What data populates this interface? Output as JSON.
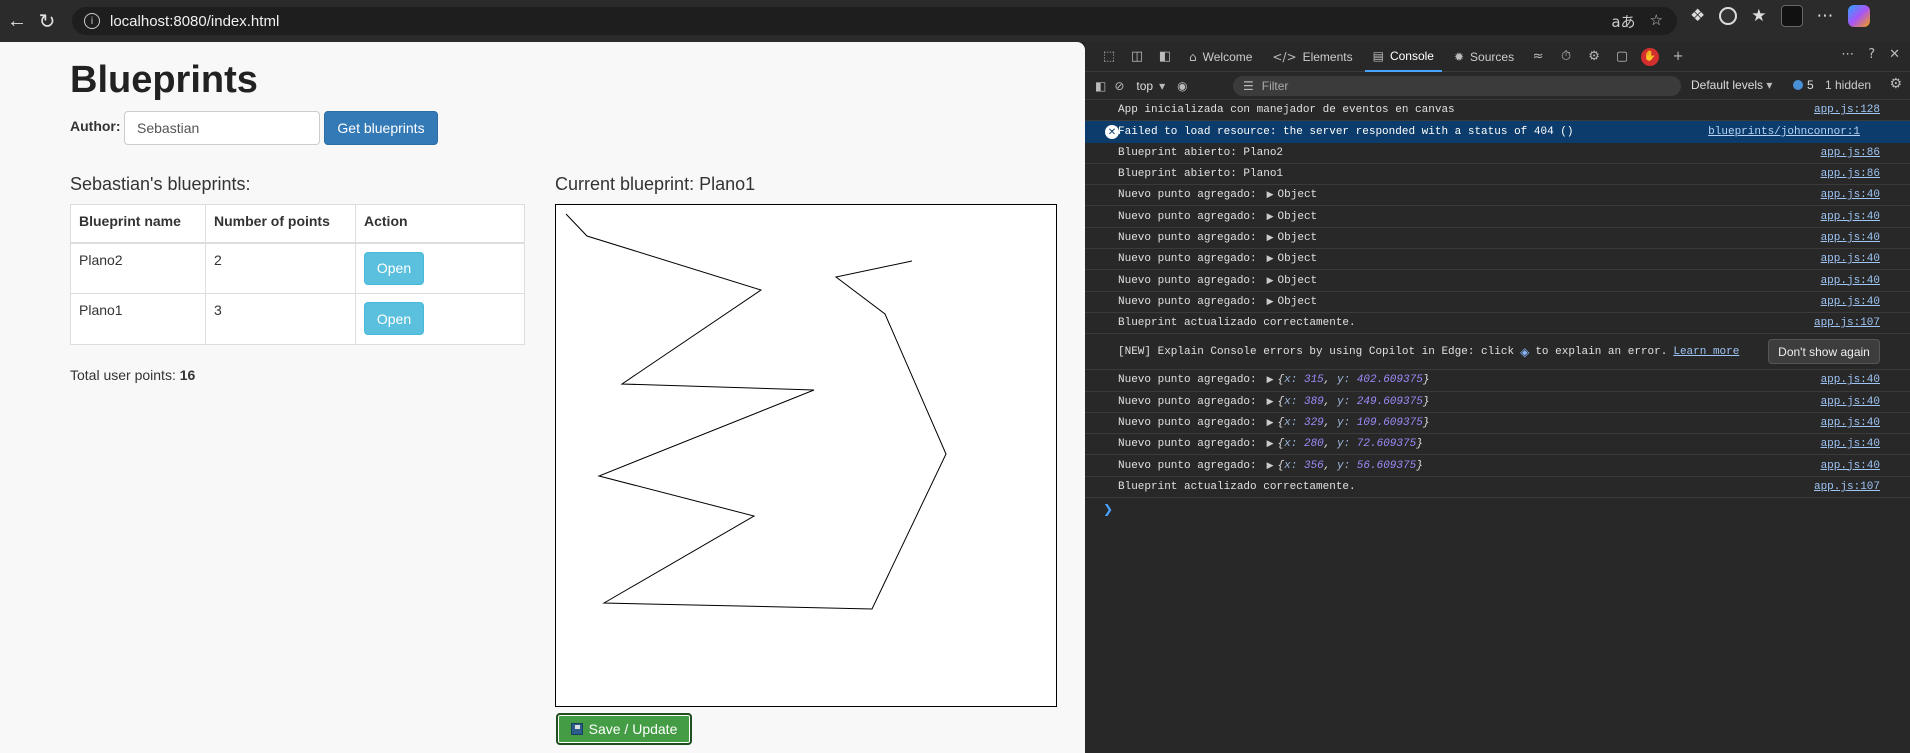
{
  "browser": {
    "url": "localhost:8080/index.html"
  },
  "app": {
    "title": "Blueprints",
    "author_label": "Author:",
    "author_value": "Sebastian",
    "get_button": "Get blueprints",
    "list_title": "Sebastian's blueprints:",
    "table": {
      "headers": [
        "Blueprint name",
        "Number of points",
        "Action"
      ],
      "rows": [
        {
          "name": "Plano2",
          "points": "2",
          "action": "Open"
        },
        {
          "name": "Plano1",
          "points": "3",
          "action": "Open"
        }
      ]
    },
    "total_label": "Total user points:",
    "total_value": "16",
    "current_title": "Current blueprint: Plano1",
    "save_button": "Save / Update"
  },
  "devtools": {
    "tabs": [
      "Welcome",
      "Elements",
      "Console",
      "Sources"
    ],
    "context": "top",
    "filter_placeholder": "Filter",
    "levels": "Default levels",
    "issues_count": "5",
    "hidden": "1 hidden",
    "logs": [
      {
        "text": "App inicializada con manejador de eventos en canvas",
        "src": "app.js:128"
      },
      {
        "text": "Failed to load resource: the server responded with a status of 404 ()",
        "src": "blueprints/johnconnor:1",
        "error": true
      },
      {
        "text": "Blueprint abierto: Plano2",
        "src": "app.js:86"
      },
      {
        "text": "Blueprint abierto: Plano1",
        "src": "app.js:86"
      },
      {
        "text": "Nuevo punto agregado:",
        "obj": "Object",
        "src": "app.js:40"
      },
      {
        "text": "Nuevo punto agregado:",
        "obj": "Object",
        "src": "app.js:40"
      },
      {
        "text": "Nuevo punto agregado:",
        "obj": "Object",
        "src": "app.js:40"
      },
      {
        "text": "Nuevo punto agregado:",
        "obj": "Object",
        "src": "app.js:40"
      },
      {
        "text": "Nuevo punto agregado:",
        "obj": "Object",
        "src": "app.js:40"
      },
      {
        "text": "Nuevo punto agregado:",
        "obj": "Object",
        "src": "app.js:40"
      },
      {
        "text": "Blueprint actualizado correctamente.",
        "src": "app.js:107"
      }
    ],
    "copilot_text_1": "[NEW] Explain Console errors by using Copilot in Edge: click",
    "copilot_text_2": "to explain an error.",
    "copilot_link": "Learn more",
    "dont_show": "Don't show again",
    "logs2": [
      {
        "text": "Nuevo punto agregado:",
        "x": "315",
        "y": "402.609375",
        "src": "app.js:40"
      },
      {
        "text": "Nuevo punto agregado:",
        "x": "389",
        "y": "249.609375",
        "src": "app.js:40"
      },
      {
        "text": "Nuevo punto agregado:",
        "x": "329",
        "y": "109.609375",
        "src": "app.js:40"
      },
      {
        "text": "Nuevo punto agregado:",
        "x": "280",
        "y": "72.609375",
        "src": "app.js:40"
      },
      {
        "text": "Nuevo punto agregado:",
        "x": "356",
        "y": "56.609375",
        "src": "app.js:40"
      },
      {
        "text": "Blueprint actualizado correctamente.",
        "src": "app.js:107"
      }
    ]
  }
}
